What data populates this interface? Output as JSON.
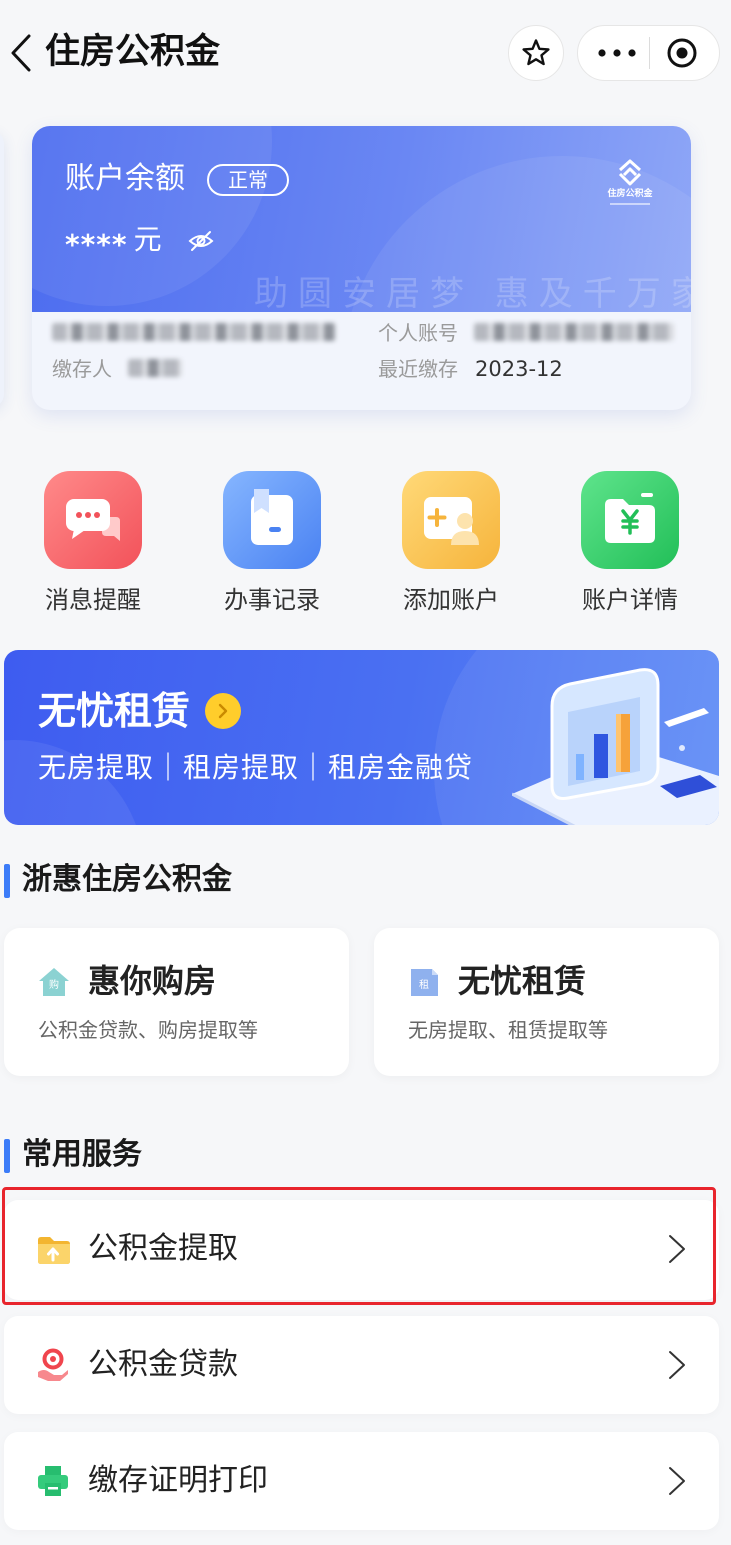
{
  "nav": {
    "back_icon": "chevron-left-icon",
    "title": "住房公积金",
    "favorite_icon": "star-icon",
    "more_icon": "more-dots-icon",
    "close_icon": "target-icon"
  },
  "account_card": {
    "balance_label": "账户余额",
    "status": "正常",
    "balance_masked": "****",
    "currency": "元",
    "visibility_icon": "eye-slash-icon",
    "logo_icon": "housing-fund-logo-icon",
    "logo_text": "住房公积金",
    "slogan": "助圆安居梦 惠及千万家",
    "account_number_label": "个人账号",
    "depositor_label": "缴存人",
    "last_deposit_label": "最近缴存",
    "last_deposit_value": "2023-12",
    "gradient_start": "#4c6cef",
    "gradient_end": "#8fa7f7"
  },
  "quick_actions": [
    {
      "label": "消息提醒",
      "icon": "message-icon",
      "color": "#f2525a"
    },
    {
      "label": "办事记录",
      "icon": "record-icon",
      "color": "#4a82f2"
    },
    {
      "label": "添加账户",
      "icon": "add-account-icon",
      "color": "#f6b43c"
    },
    {
      "label": "账户详情",
      "icon": "account-detail-icon",
      "color": "#22bf58"
    }
  ],
  "banner": {
    "title": "无忧租赁",
    "arrow_icon": "chevron-right-circle-icon",
    "subtitle": "无房提取｜租房提取｜租房金融贷",
    "illustration": "chart-device-illustration",
    "background_color": "#4a70f2"
  },
  "featured_section": {
    "title": "浙惠住房公积金",
    "cards": [
      {
        "icon": "house-purchase-icon",
        "icon_text": "购",
        "title": "惠你购房",
        "subtitle": "公积金贷款、购房提取等"
      },
      {
        "icon": "rent-icon",
        "icon_text": "租",
        "title": "无忧租赁",
        "subtitle": "无房提取、租赁提取等"
      }
    ]
  },
  "services_section": {
    "title": "常用服务",
    "chevron_icon": "chevron-right-icon",
    "highlight_color": "#e8252d",
    "items": [
      {
        "label": "公积金提取",
        "icon": "folder-upload-icon",
        "highlighted": true
      },
      {
        "label": "公积金贷款",
        "icon": "loan-icon",
        "highlighted": false
      },
      {
        "label": "缴存证明打印",
        "icon": "printer-icon",
        "highlighted": false
      }
    ]
  },
  "accent_color": "#3c7cf8"
}
